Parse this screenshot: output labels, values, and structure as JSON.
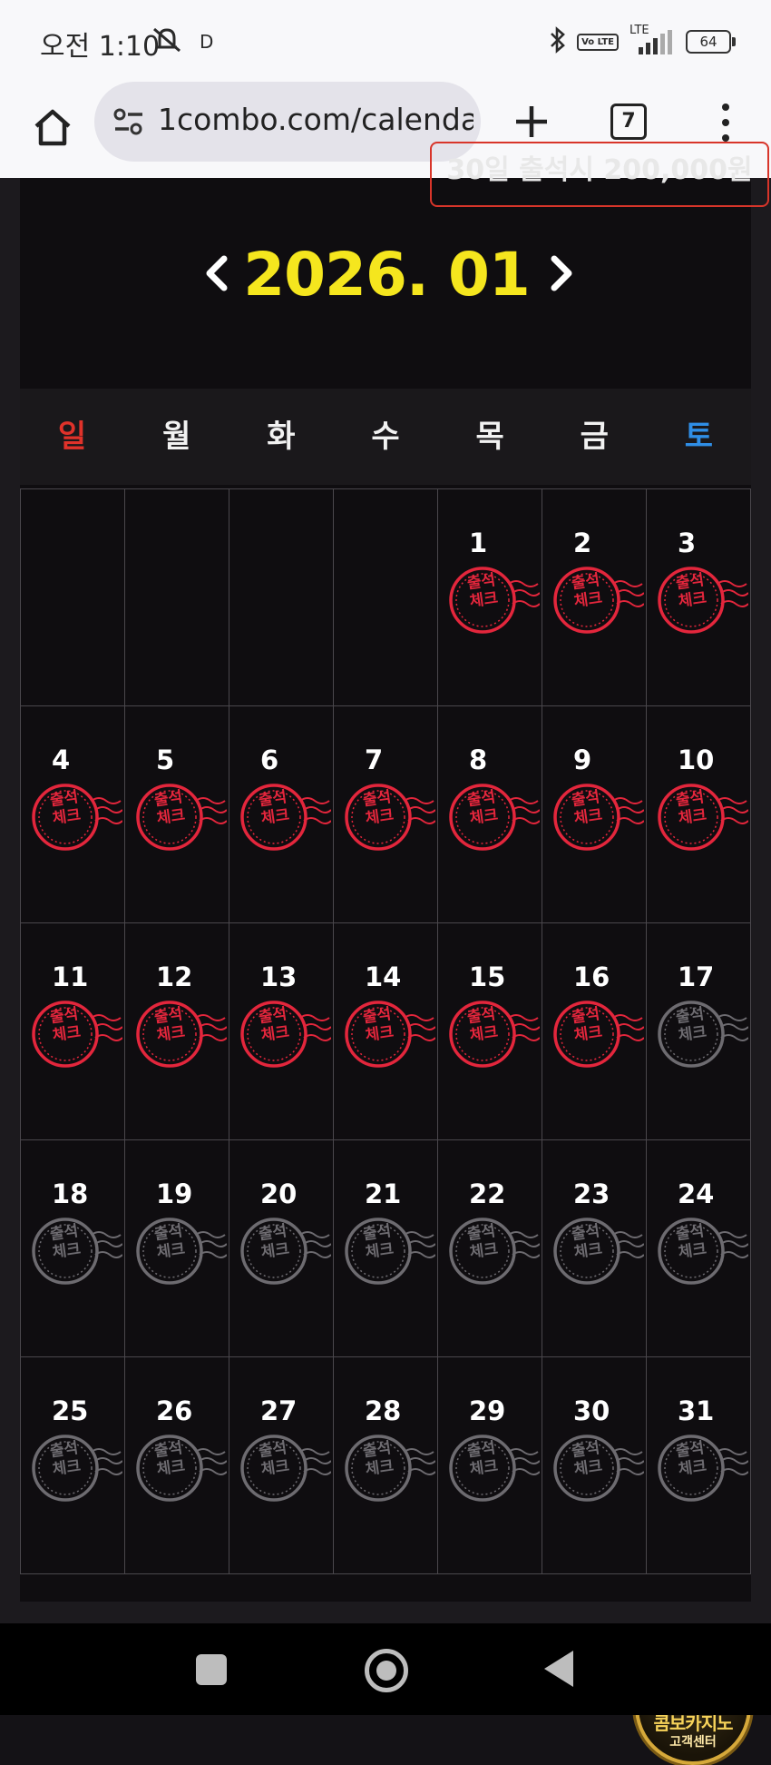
{
  "status_bar": {
    "time": "오전 1:10",
    "indicator": "D",
    "volte": "Vo LTE",
    "lte": "LTE",
    "battery": "64"
  },
  "browser": {
    "url": "1combo.com/calenda",
    "tab_count": "7"
  },
  "banner": {
    "text": "30일 출석시 200,000원"
  },
  "calendar": {
    "month_title": "2026. 01",
    "weekdays": [
      "일",
      "월",
      "화",
      "수",
      "목",
      "금",
      "토"
    ],
    "stamp_label_line1": "출석",
    "stamp_label_line2": "체크",
    "weeks": [
      [
        {
          "day": "",
          "checked": false
        },
        {
          "day": "",
          "checked": false
        },
        {
          "day": "",
          "checked": false
        },
        {
          "day": "",
          "checked": false
        },
        {
          "day": "1",
          "checked": true
        },
        {
          "day": "2",
          "checked": true
        },
        {
          "day": "3",
          "checked": true
        }
      ],
      [
        {
          "day": "4",
          "checked": true
        },
        {
          "day": "5",
          "checked": true
        },
        {
          "day": "6",
          "checked": true
        },
        {
          "day": "7",
          "checked": true
        },
        {
          "day": "8",
          "checked": true
        },
        {
          "day": "9",
          "checked": true
        },
        {
          "day": "10",
          "checked": true
        }
      ],
      [
        {
          "day": "11",
          "checked": true
        },
        {
          "day": "12",
          "checked": true
        },
        {
          "day": "13",
          "checked": true
        },
        {
          "day": "14",
          "checked": true
        },
        {
          "day": "15",
          "checked": true
        },
        {
          "day": "16",
          "checked": true
        },
        {
          "day": "17",
          "checked": false
        }
      ],
      [
        {
          "day": "18",
          "checked": false
        },
        {
          "day": "19",
          "checked": false
        },
        {
          "day": "20",
          "checked": false
        },
        {
          "day": "21",
          "checked": false
        },
        {
          "day": "22",
          "checked": false
        },
        {
          "day": "23",
          "checked": false
        },
        {
          "day": "24",
          "checked": false
        }
      ],
      [
        {
          "day": "25",
          "checked": false
        },
        {
          "day": "26",
          "checked": false
        },
        {
          "day": "27",
          "checked": false
        },
        {
          "day": "28",
          "checked": false
        },
        {
          "day": "29",
          "checked": false
        },
        {
          "day": "30",
          "checked": false
        },
        {
          "day": "31",
          "checked": false
        }
      ]
    ]
  },
  "customer_center": {
    "title": "콤보카지노",
    "subtitle": "고객센터"
  },
  "colors": {
    "month_title": "#f5e61e",
    "sunday": "#e0322a",
    "saturday": "#2f8ee6",
    "stamp_checked": "#e3263c",
    "stamp_unchecked": "#6d6b70"
  }
}
